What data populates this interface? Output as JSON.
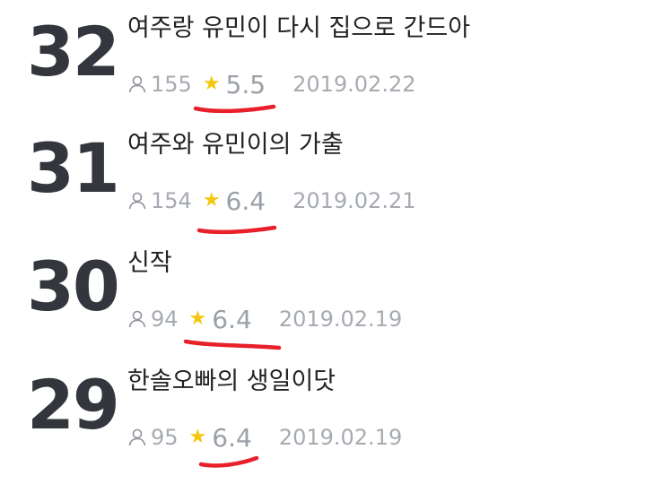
{
  "episodes": [
    {
      "number": "32",
      "title": "여주랑 유민이 다시 집으로 간드아",
      "views": "155",
      "rating": "5.5",
      "date": "2019.02.22"
    },
    {
      "number": "31",
      "title": "여주와 유민이의 가출",
      "views": "154",
      "rating": "6.4",
      "date": "2019.02.21"
    },
    {
      "number": "30",
      "title": "신작",
      "views": "94",
      "rating": "6.4",
      "date": "2019.02.19"
    },
    {
      "number": "29",
      "title": "한솔오빠의 생일이닷",
      "views": "95",
      "rating": "6.4",
      "date": "2019.02.19"
    }
  ],
  "icons": {
    "views": "person-icon",
    "rating": "star-icon"
  },
  "colors": {
    "number": "#33373d",
    "title": "#222222",
    "meta": "#a6abb2",
    "star": "#f5c711",
    "annotation": "#e8202a"
  }
}
